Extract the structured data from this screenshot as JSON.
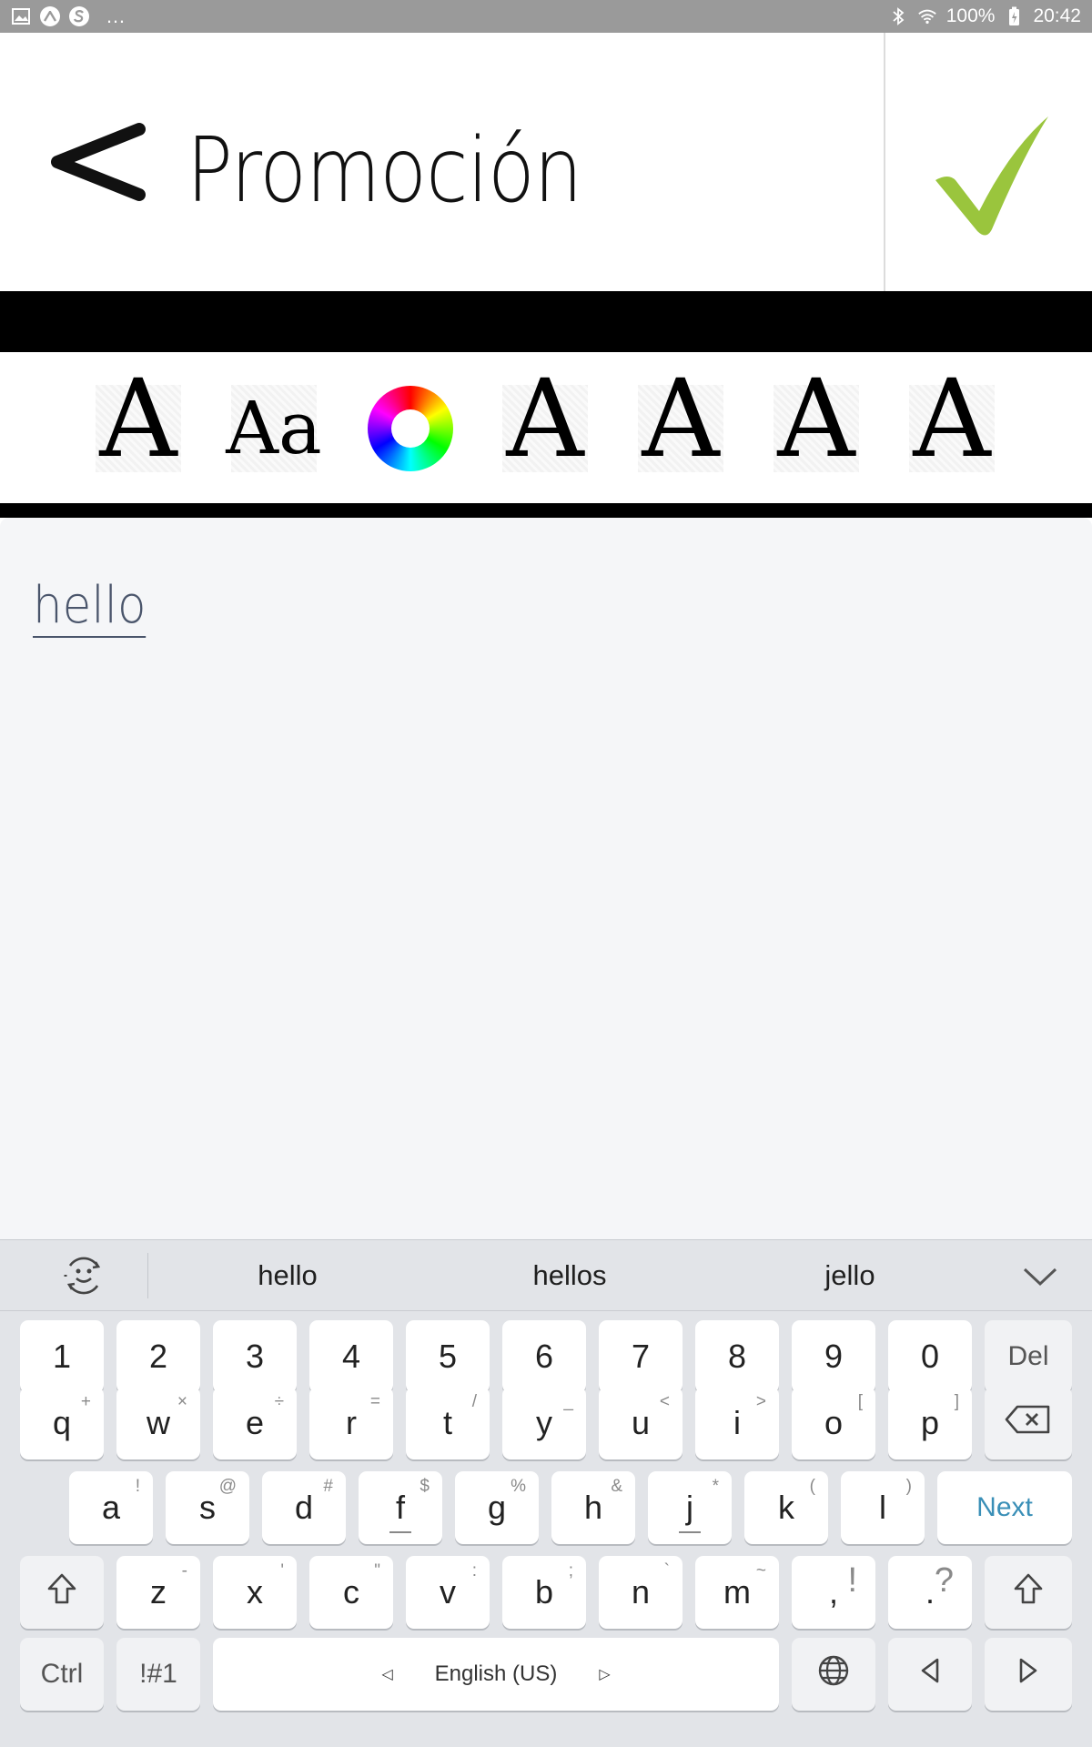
{
  "status_bar": {
    "battery": "100%",
    "time": "20:42",
    "more": "…"
  },
  "header": {
    "title": "Promoción"
  },
  "toolbar": {
    "tool_a_glyph": "A",
    "tool_aa_glyph": "Aa"
  },
  "editor": {
    "text": "hello"
  },
  "keyboard": {
    "suggestions": [
      "hello",
      "hellos",
      "jello"
    ],
    "row_numbers": [
      "1",
      "2",
      "3",
      "4",
      "5",
      "6",
      "7",
      "8",
      "9",
      "0"
    ],
    "del_label": "Del",
    "row_q": [
      {
        "k": "q",
        "h": "+"
      },
      {
        "k": "w",
        "h": "×"
      },
      {
        "k": "e",
        "h": "÷"
      },
      {
        "k": "r",
        "h": "="
      },
      {
        "k": "t",
        "h": "/"
      },
      {
        "k": "y",
        "h": "_"
      },
      {
        "k": "u",
        "h": "<"
      },
      {
        "k": "i",
        "h": ">"
      },
      {
        "k": "o",
        "h": "["
      },
      {
        "k": "p",
        "h": "]"
      }
    ],
    "row_a": [
      {
        "k": "a",
        "h": "!"
      },
      {
        "k": "s",
        "h": "@"
      },
      {
        "k": "d",
        "h": "#"
      },
      {
        "k": "f",
        "h": "$"
      },
      {
        "k": "g",
        "h": "%"
      },
      {
        "k": "h",
        "h": "&"
      },
      {
        "k": "j",
        "h": "*"
      },
      {
        "k": "k",
        "h": "("
      },
      {
        "k": "l",
        "h": ")"
      }
    ],
    "next_label": "Next",
    "row_z": [
      {
        "k": "z",
        "h": "-"
      },
      {
        "k": "x",
        "h": "'"
      },
      {
        "k": "c",
        "h": "\""
      },
      {
        "k": "v",
        "h": ":"
      },
      {
        "k": "b",
        "h": ";"
      },
      {
        "k": "n",
        "h": "`"
      },
      {
        "k": "m",
        "h": "~"
      }
    ],
    "comma": ",",
    "comma_hint": "!",
    "period": ".",
    "period_hint": "?",
    "ctrl_label": "Ctrl",
    "symbols_label": "!#1",
    "space_label": "English (US)"
  },
  "colors": {
    "status_bar": "#9a9a9a",
    "check_green": "#9ac53d",
    "text_color": "#4a556b",
    "next_color": "#3a8fb7",
    "keyboard_bg": "#e2e4e8"
  }
}
